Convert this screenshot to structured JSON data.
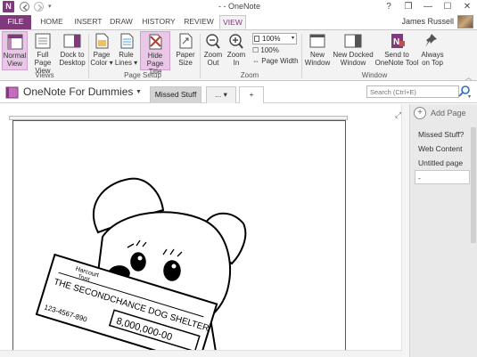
{
  "app": {
    "title": "- - OneNote",
    "logo": "N"
  },
  "window_controls": {
    "help": "?",
    "restore": "❐",
    "minimize": "—",
    "maximize": "☐",
    "close": "✕"
  },
  "tabs": {
    "file": "FILE",
    "home": "HOME",
    "insert": "INSERT",
    "draw": "DRAW",
    "history": "HISTORY",
    "review": "REVIEW",
    "view": "VIEW"
  },
  "user": {
    "name": "James Russell"
  },
  "ribbon": {
    "views": {
      "group_label": "Views",
      "normal_view": [
        "Normal",
        "View"
      ],
      "full_page_view": [
        "Full Page",
        "View"
      ],
      "dock_to_desktop": [
        "Dock to",
        "Desktop"
      ]
    },
    "page_setup": {
      "group_label": "Page Setup",
      "page_color": [
        "Page",
        "Color ▾"
      ],
      "rule_lines": [
        "Rule",
        "Lines ▾"
      ],
      "hide_page_title": [
        "Hide",
        "Page Title"
      ],
      "paper_size": [
        "Paper",
        "Size"
      ]
    },
    "zoom": {
      "group_label": "Zoom",
      "zoom_out": [
        "Zoom",
        "Out"
      ],
      "zoom_in": [
        "Zoom",
        "In"
      ],
      "zoom_value": "100%",
      "hundred_percent": "100%",
      "page_width": "Page Width"
    },
    "window": {
      "group_label": "Window",
      "new_window": [
        "New",
        "Window"
      ],
      "new_docked_window": [
        "New Docked",
        "Window"
      ],
      "send_to_onenote": [
        "Send to",
        "OneNote Tool"
      ],
      "always_on_top": [
        "Always",
        "on Top"
      ]
    }
  },
  "notebook": {
    "name": "OneNote For Dummies",
    "sections": [
      "Missed Stuff",
      "..."
    ],
    "add_section": "+"
  },
  "search": {
    "placeholder": "Search (Ctrl+E)"
  },
  "page_pane": {
    "add_page": "Add Page",
    "pages": [
      "Missed Stuff?",
      "Web Content",
      "Untitled page",
      "-"
    ],
    "selected_index": 3
  },
  "page_image": {
    "check_lines": [
      "Harcourt",
      "Trust"
    ],
    "payee": "THE SECONDCHANCE DOG SHELTER",
    "amount": "8,000,000-00",
    "account": "123-4567-890"
  },
  "colors": {
    "accent": "#80397b",
    "active_button": "#e8c8e6",
    "ribbon_bg": "#f3f3f3"
  }
}
